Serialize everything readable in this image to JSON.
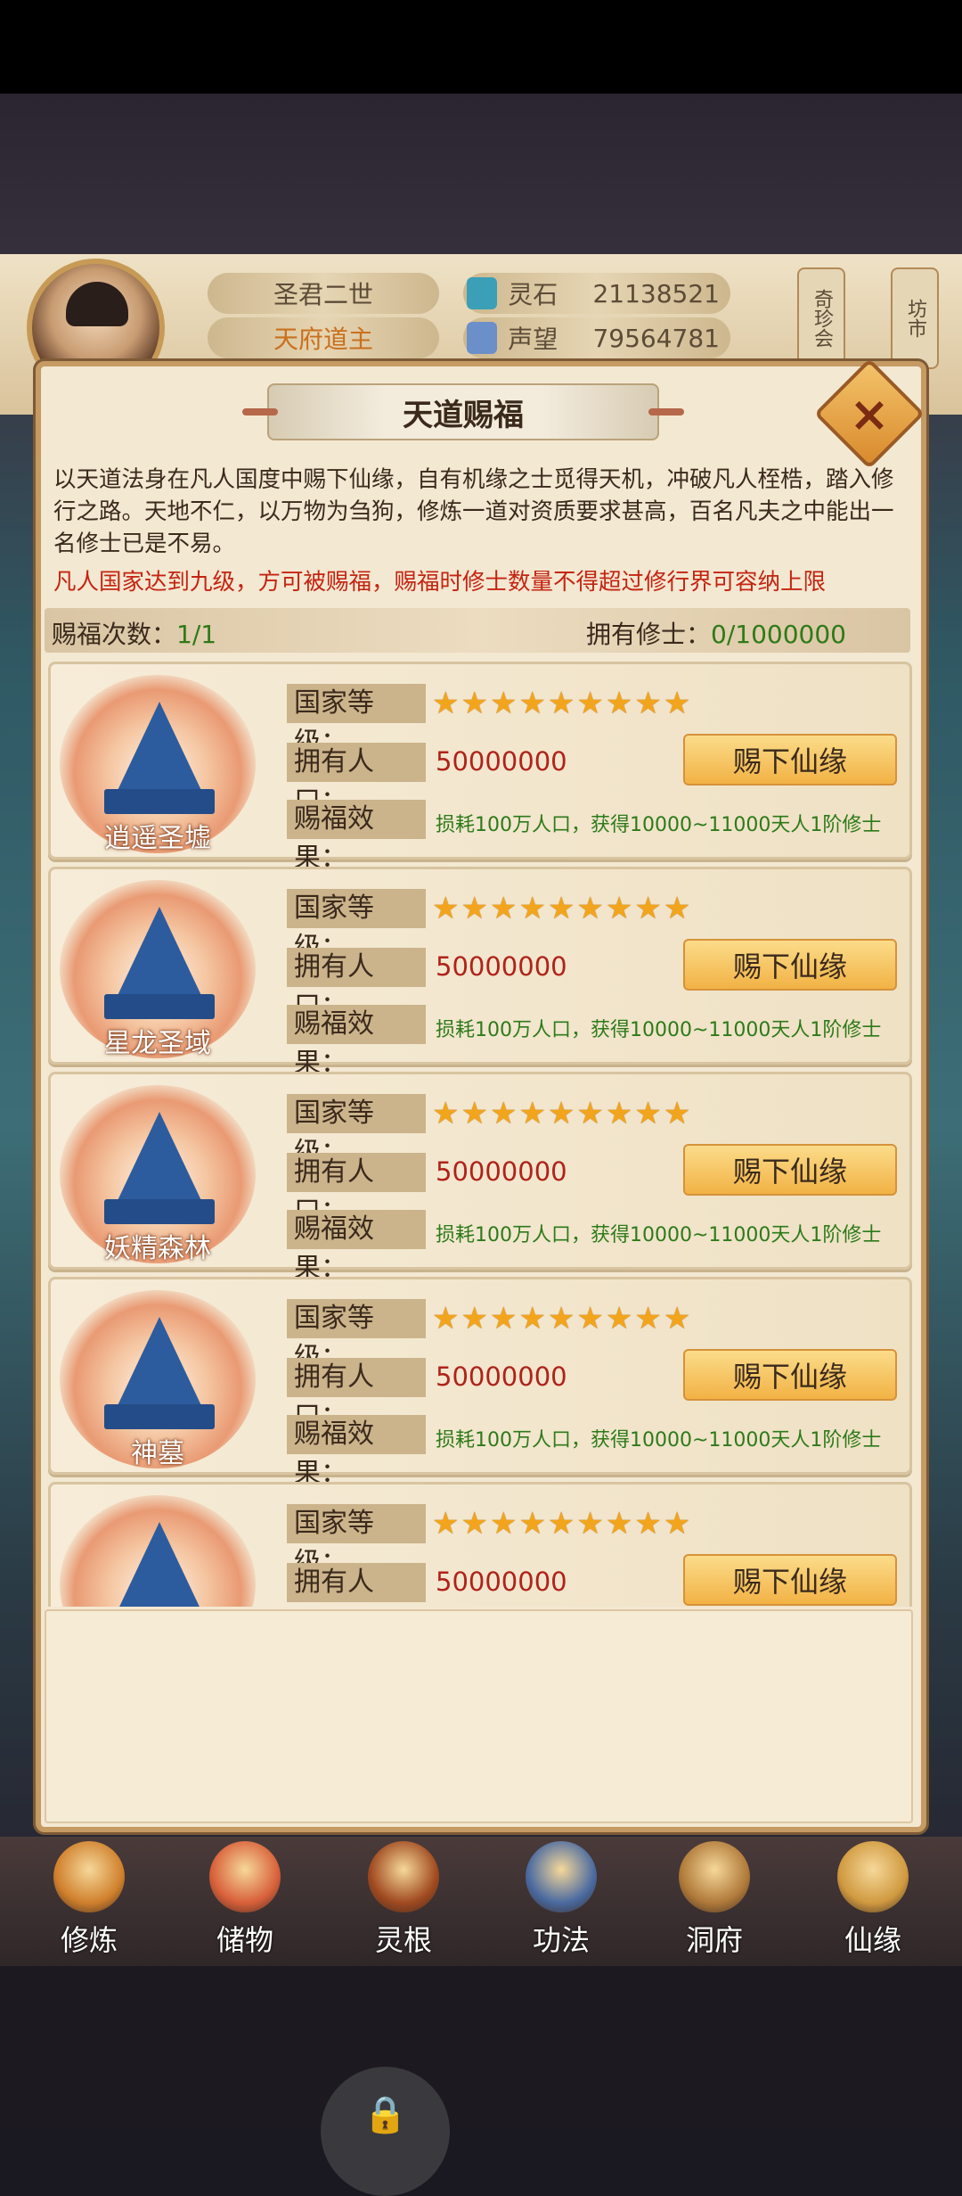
{
  "header": {
    "player_name": "圣君二世",
    "player_title": "天府道主",
    "spirit_stone_label": "灵石",
    "spirit_stone_value": "21138521",
    "prestige_label": "声望",
    "prestige_value": "79564781",
    "side_tab_1": "奇珍会",
    "side_tab_2": "坊市"
  },
  "dialog": {
    "title": "天道赐福",
    "description": "以天道法身在凡人国度中赐下仙缘，自有机缘之士觅得天机，冲破凡人桎梏，踏入修行之路。天地不仁，以万物为刍狗，修炼一道对资质要求甚高，百名凡夫之中能出一名修士已是不易。",
    "requirement": "凡人国家达到九级，方可被赐福，赐福时修士数量不得超过修行界可容纳上限",
    "bless_count_label": "赐福次数：",
    "bless_count_value": "1/1",
    "cultivators_label": "拥有修士：",
    "cultivators_value": "0/1000000"
  },
  "card_labels": {
    "level": "国家等级：",
    "population": "拥有人口：",
    "effect": "赐福效果："
  },
  "countries": [
    {
      "name": "逍遥圣墟",
      "stars": "★★★★★★★★★",
      "population": "50000000",
      "effect": "损耗100万人口，获得10000~11000天人1阶修士",
      "button": "赐下仙缘"
    },
    {
      "name": "星龙圣域",
      "stars": "★★★★★★★★★",
      "population": "50000000",
      "effect": "损耗100万人口，获得10000~11000天人1阶修士",
      "button": "赐下仙缘"
    },
    {
      "name": "妖精森林",
      "stars": "★★★★★★★★★",
      "population": "50000000",
      "effect": "损耗100万人口，获得10000~11000天人1阶修士",
      "button": "赐下仙缘"
    },
    {
      "name": "神墓",
      "stars": "★★★★★★★★★",
      "population": "50000000",
      "effect": "损耗100万人口，获得10000~11000天人1阶修士",
      "button": "赐下仙缘"
    },
    {
      "name": "",
      "stars": "★★★★★★★★★",
      "population": "50000000",
      "effect": "",
      "button": "赐下仙缘"
    }
  ],
  "nav": [
    {
      "label": "修炼",
      "icon": "cultivate-icon",
      "color": "#d0802c"
    },
    {
      "label": "储物",
      "icon": "storage-bag-icon",
      "color": "#d8603a"
    },
    {
      "label": "灵根",
      "icon": "spirit-root-icon",
      "color": "#a04a20"
    },
    {
      "label": "功法",
      "icon": "technique-book-icon",
      "color": "#4a6aa0"
    },
    {
      "label": "洞府",
      "icon": "cave-mansion-icon",
      "color": "#b07a3a"
    },
    {
      "label": "仙缘",
      "icon": "fortune-gourd-icon",
      "color": "#d09a40"
    }
  ],
  "close_icon": "×",
  "lock_icon": "🔒"
}
